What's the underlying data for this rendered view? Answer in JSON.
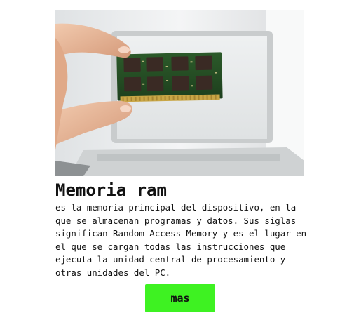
{
  "card": {
    "image_subject": "hand holding a RAM memory module in front of a laptop",
    "title": "Memoria ram",
    "description": "es la memoria principal del dispositivo, en la que se almacenan programas y datos. Sus siglas significan Random Access Memory y es el lugar en el que se cargan todas las instrucciones que ejecuta la unidad central de procesamiento y otras unidades del PC.",
    "more_button_label": "mas"
  },
  "colors": {
    "button_background": "#3ef222",
    "text": "#111111",
    "page_background": "#ffffff"
  }
}
